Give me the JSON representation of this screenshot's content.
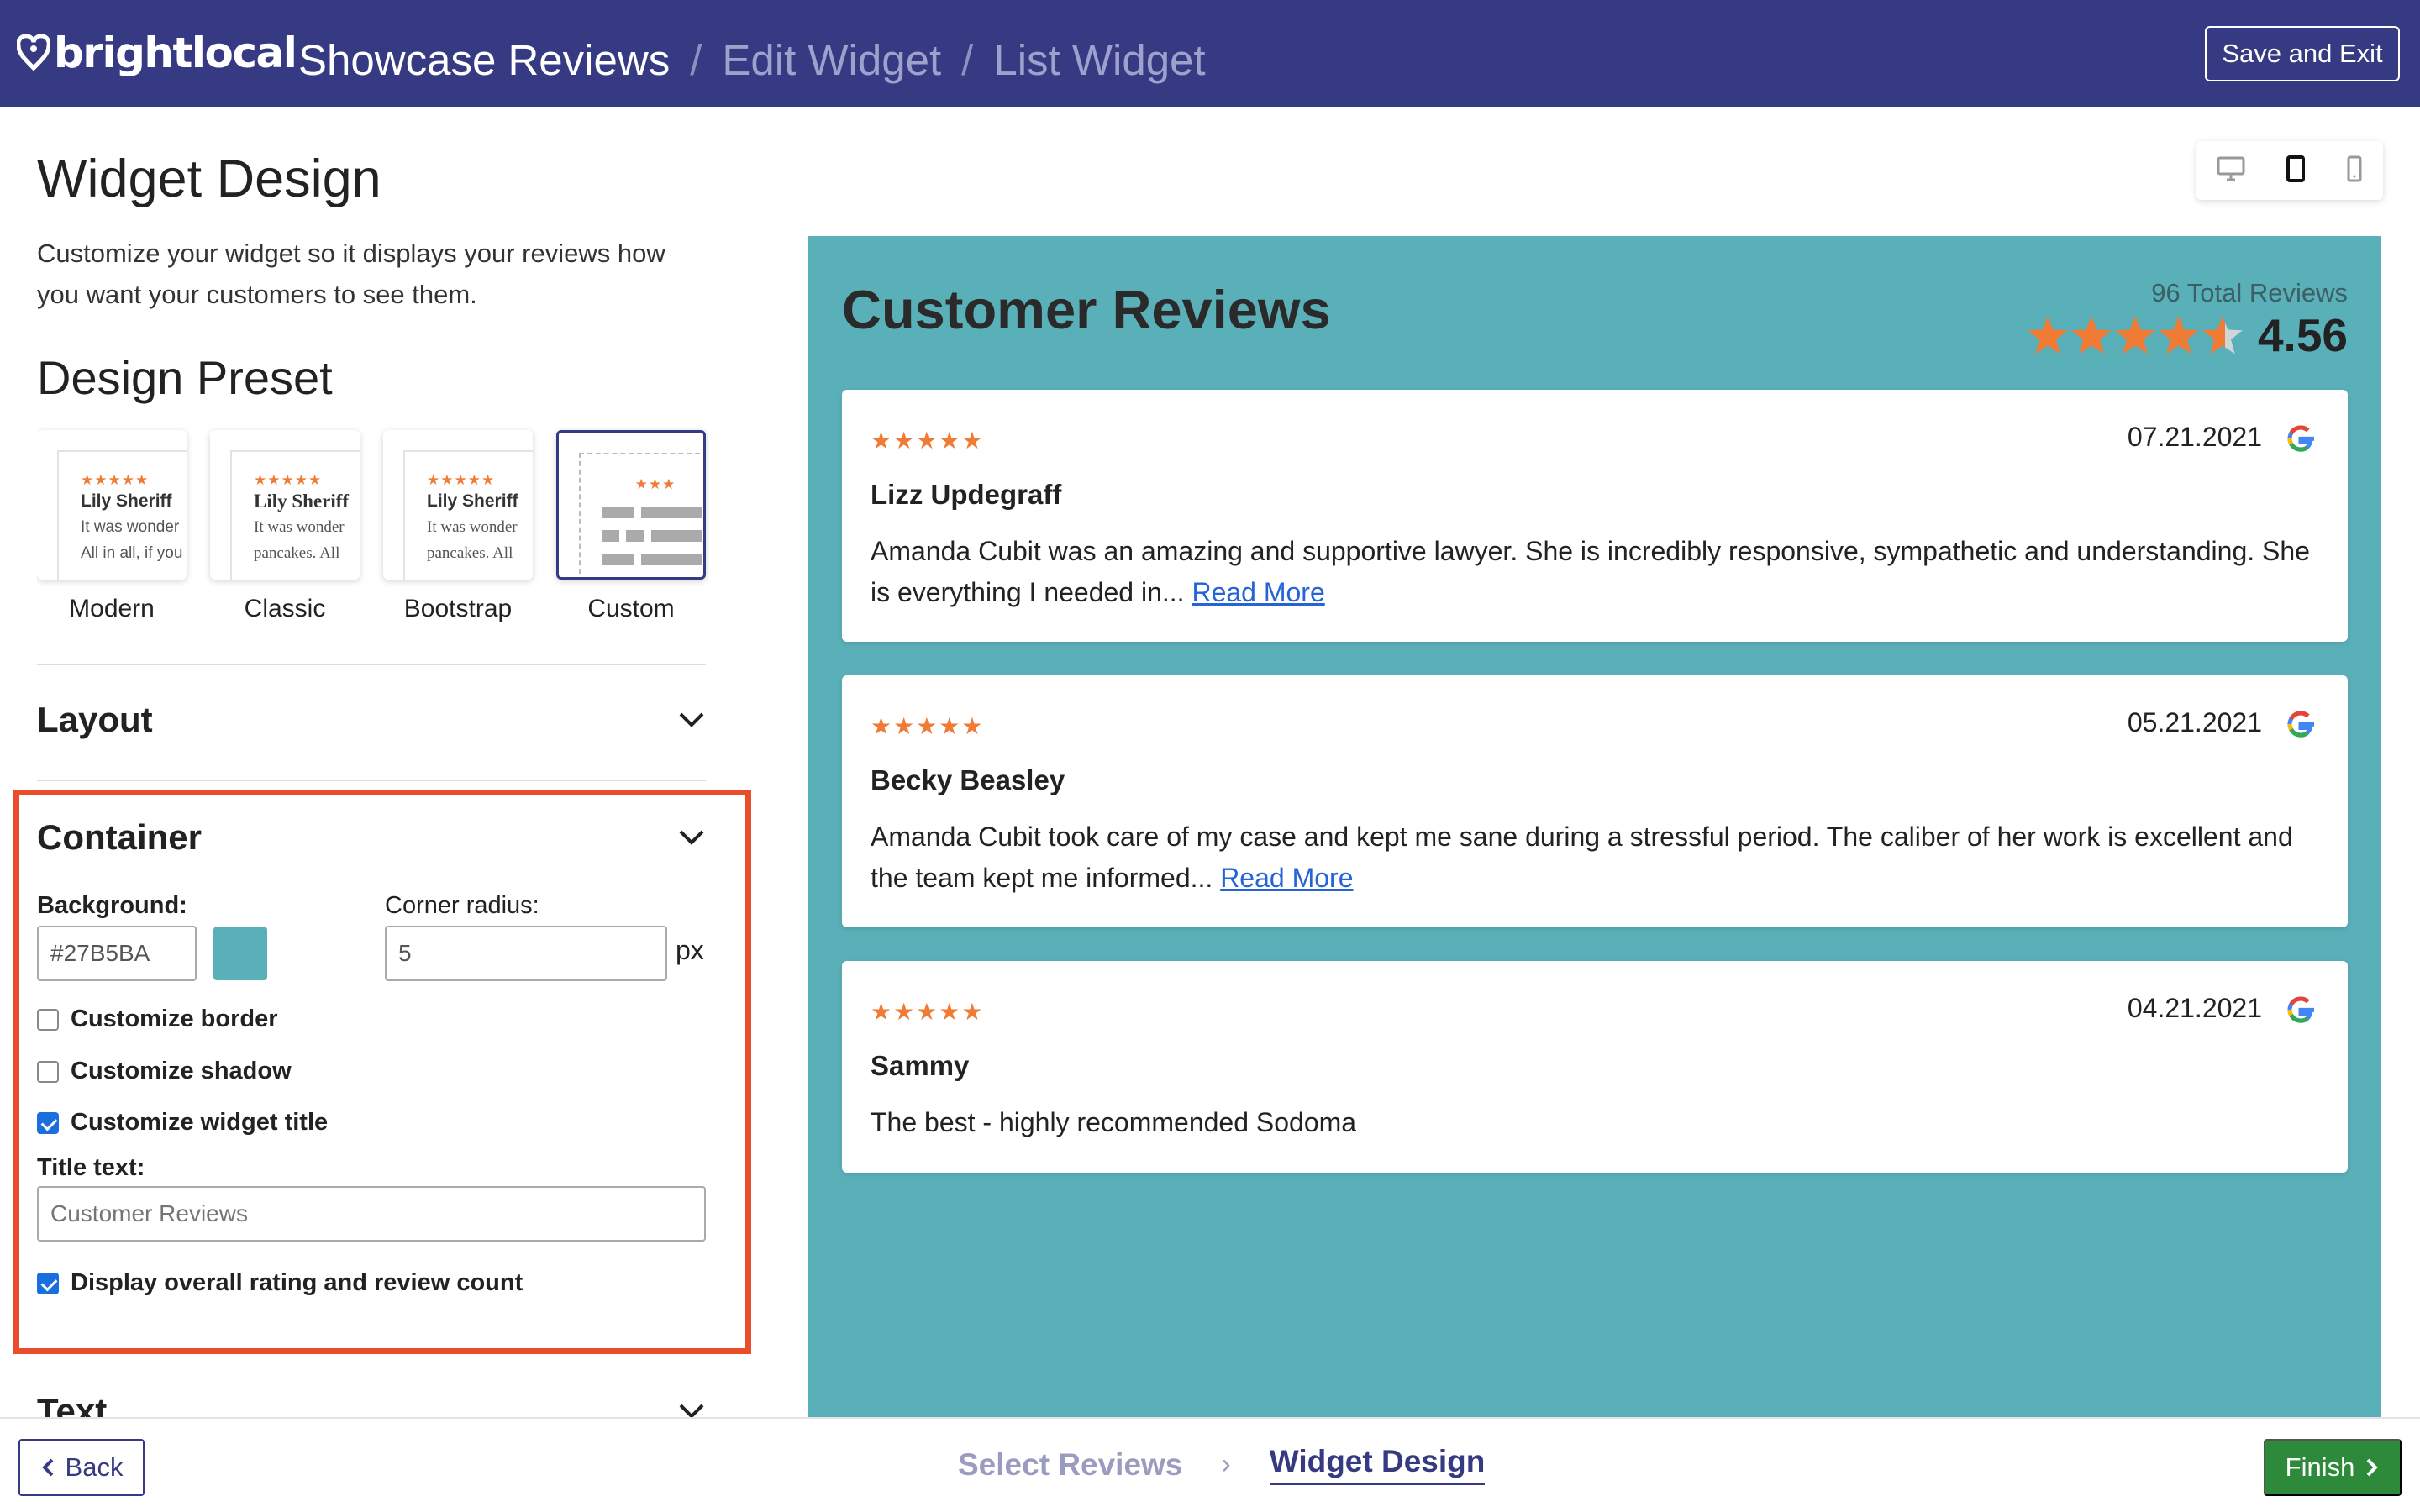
{
  "header": {
    "logo_text": "brightlocal",
    "breadcrumb": [
      "Showcase Reviews",
      "Edit Widget",
      "List Widget"
    ],
    "save_exit_label": "Save and Exit"
  },
  "left": {
    "title": "Widget Design",
    "description": "Customize your widget so it displays your reviews how you want your customers to see them.",
    "preset_heading": "Design Preset",
    "presets": [
      {
        "label": "Modern",
        "sample_name": "Lily Sheriff",
        "sample_line1": "It was wonder",
        "sample_line2": "All in all, if you"
      },
      {
        "label": "Classic",
        "sample_name": "Lily Sheriff",
        "sample_line1": "It was wonder",
        "sample_line2": "pancakes. All"
      },
      {
        "label": "Bootstrap",
        "sample_name": "Lily Sheriff",
        "sample_line1": "It was wonder",
        "sample_line2": "pancakes. All"
      },
      {
        "label": "Custom"
      }
    ],
    "selected_preset": "Custom",
    "sections": {
      "layout": "Layout",
      "container": "Container",
      "text": "Text"
    },
    "container": {
      "background_label": "Background:",
      "background_value": "#27B5BA",
      "background_swatch": "#5ab0b9",
      "corner_radius_label": "Corner radius:",
      "corner_radius_value": "5",
      "corner_radius_unit": "px",
      "customize_border": "Customize border",
      "customize_border_checked": false,
      "customize_shadow": "Customize shadow",
      "customize_shadow_checked": false,
      "customize_title": "Customize widget title",
      "customize_title_checked": true,
      "title_text_label": "Title text:",
      "title_text_placeholder": "Customer Reviews",
      "display_rating": "Display overall rating and review count",
      "display_rating_checked": true
    }
  },
  "preview": {
    "background": "#5ab0b9",
    "title": "Customer Reviews",
    "total_reviews": "96 Total Reviews",
    "rating": "4.56",
    "rating_value": 4.56,
    "reviews": [
      {
        "stars": "★★★★★",
        "date": "07.21.2021",
        "name": "Lizz Updegraff",
        "text": "Amanda Cubit was an amazing and supportive lawyer. She is incredibly responsive, sympathetic and understanding. She is everything I needed in...",
        "more": "Read More"
      },
      {
        "stars": "★★★★★",
        "date": "05.21.2021",
        "name": "Becky Beasley",
        "text": "Amanda Cubit took care of my case and kept me sane during a stressful period. The caliber of her work is excellent and the team kept me informed...",
        "more": "Read More"
      },
      {
        "stars": "★★★★★",
        "date": "04.21.2021",
        "name": "Sammy",
        "text": "The best - highly recommended Sodoma",
        "more": ""
      }
    ]
  },
  "footer": {
    "back_label": "Back",
    "step1": "Select Reviews",
    "step2": "Widget Design",
    "finish_label": "Finish"
  },
  "colors": {
    "header_bg": "#363a82",
    "accent_red": "#e94d2c",
    "star_orange": "#ef7b35",
    "finish_green": "#2c8a3a",
    "link_blue": "#2563d6"
  }
}
